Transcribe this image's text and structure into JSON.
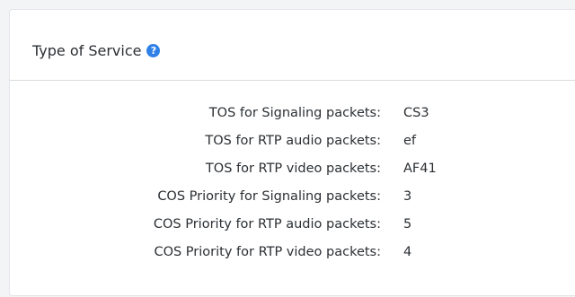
{
  "panel": {
    "title": "Type of Service",
    "help_icon": "question-circle-icon",
    "accent_color": "#2f80e7"
  },
  "rows": [
    {
      "label": "TOS for Signaling packets:",
      "value": "CS3"
    },
    {
      "label": "TOS for RTP audio packets:",
      "value": "ef"
    },
    {
      "label": "TOS for RTP video packets:",
      "value": "AF41"
    },
    {
      "label": "COS Priority for Signaling packets:",
      "value": "3"
    },
    {
      "label": "COS Priority for RTP audio packets:",
      "value": "5"
    },
    {
      "label": "COS Priority for RTP video packets:",
      "value": "4"
    }
  ]
}
